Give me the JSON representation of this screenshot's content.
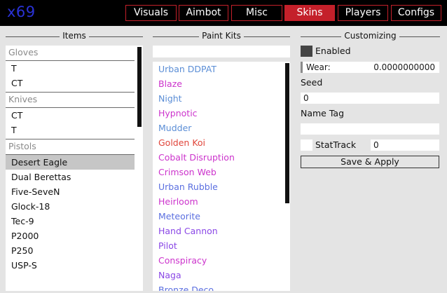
{
  "logo": "x69",
  "tabs": [
    {
      "label": "Visuals"
    },
    {
      "label": "Aimbot"
    },
    {
      "label": "Misc"
    },
    {
      "label": "Skins"
    },
    {
      "label": "Players"
    },
    {
      "label": "Configs"
    }
  ],
  "active_tab": "Skins",
  "colors": {
    "accent": "#c4202a",
    "logo": "#2a32d6",
    "rarity_blue": "#4b7ed3",
    "rarity_purple": "#8a47e6",
    "rarity_pink": "#cc33cc",
    "rarity_red": "#e0453a"
  },
  "sections": {
    "items": "Items",
    "paint_kits": "Paint Kits",
    "customizing": "Customizing"
  },
  "items": {
    "groups": [
      {
        "label": "Gloves",
        "entries": [
          "T",
          "CT"
        ]
      },
      {
        "label": "Knives",
        "entries": [
          "CT",
          "T"
        ]
      },
      {
        "label": "Pistols",
        "entries": [
          "Desert Eagle",
          "Dual Berettas",
          "Five-SeveN",
          "Glock-18",
          "Tec-9",
          "P2000",
          "P250",
          "USP-S"
        ]
      }
    ],
    "selected": "Desert Eagle"
  },
  "paint_kits": {
    "search_value": "",
    "list": [
      {
        "name": "Urban DDPAT",
        "color": "#5b8ed6"
      },
      {
        "name": "Blaze",
        "color": "#cc33cc"
      },
      {
        "name": "Night",
        "color": "#5b8ed6"
      },
      {
        "name": "Hypnotic",
        "color": "#cc33cc"
      },
      {
        "name": "Mudder",
        "color": "#5b8ed6"
      },
      {
        "name": "Golden Koi",
        "color": "#e0453a"
      },
      {
        "name": "Cobalt Disruption",
        "color": "#cc33cc"
      },
      {
        "name": "Crimson Web",
        "color": "#cc33cc"
      },
      {
        "name": "Urban Rubble",
        "color": "#5b6fe0"
      },
      {
        "name": "Heirloom",
        "color": "#cc33cc"
      },
      {
        "name": "Meteorite",
        "color": "#5b6fe0"
      },
      {
        "name": "Hand Cannon",
        "color": "#8a47e6"
      },
      {
        "name": "Pilot",
        "color": "#8a47e6"
      },
      {
        "name": "Conspiracy",
        "color": "#cc33cc"
      },
      {
        "name": "Naga",
        "color": "#8a47e6"
      },
      {
        "name": "Bronze Deco",
        "color": "#5b6fe0"
      }
    ]
  },
  "customizing": {
    "enabled_label": "Enabled",
    "wear_label": "Wear:",
    "wear_value": "0.0000000000",
    "seed_label": "Seed",
    "seed_value": "0",
    "name_tag_label": "Name Tag",
    "name_tag_value": "",
    "stattrack_label": "StatTrack",
    "stattrack_value": "0",
    "apply_label": "Save & Apply"
  }
}
